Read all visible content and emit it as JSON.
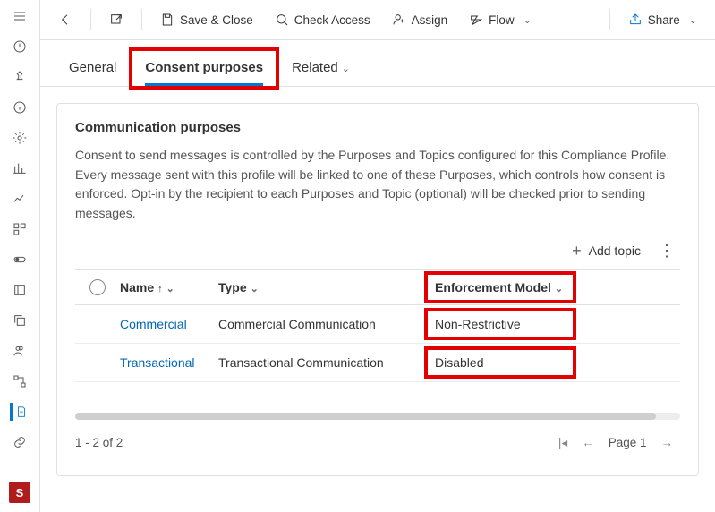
{
  "toolbar": {
    "save": "Save & Close",
    "check": "Check Access",
    "assign": "Assign",
    "flow": "Flow",
    "share": "Share"
  },
  "tabs": {
    "general": "General",
    "consent": "Consent purposes",
    "related": "Related"
  },
  "card": {
    "title": "Communication purposes",
    "desc": "Consent to send messages is controlled by the Purposes and Topics configured for this Compliance Profile. Every message sent with this profile will be linked to one of these Purposes, which controls how consent is enforced. Opt-in by the recipient to each Purposes and Topic (optional) will be checked prior to sending messages.",
    "add": "Add topic"
  },
  "grid": {
    "cols": {
      "name": "Name",
      "type": "Type",
      "enf": "Enforcement Model"
    },
    "rows": [
      {
        "name": "Commercial",
        "type": "Commercial Communication",
        "enf": "Non-Restrictive"
      },
      {
        "name": "Transactional",
        "type": "Transactional Communication",
        "enf": "Disabled"
      }
    ]
  },
  "pager": {
    "status": "1 - 2 of 2",
    "page": "Page 1"
  },
  "rail": {
    "avatar": "S"
  }
}
